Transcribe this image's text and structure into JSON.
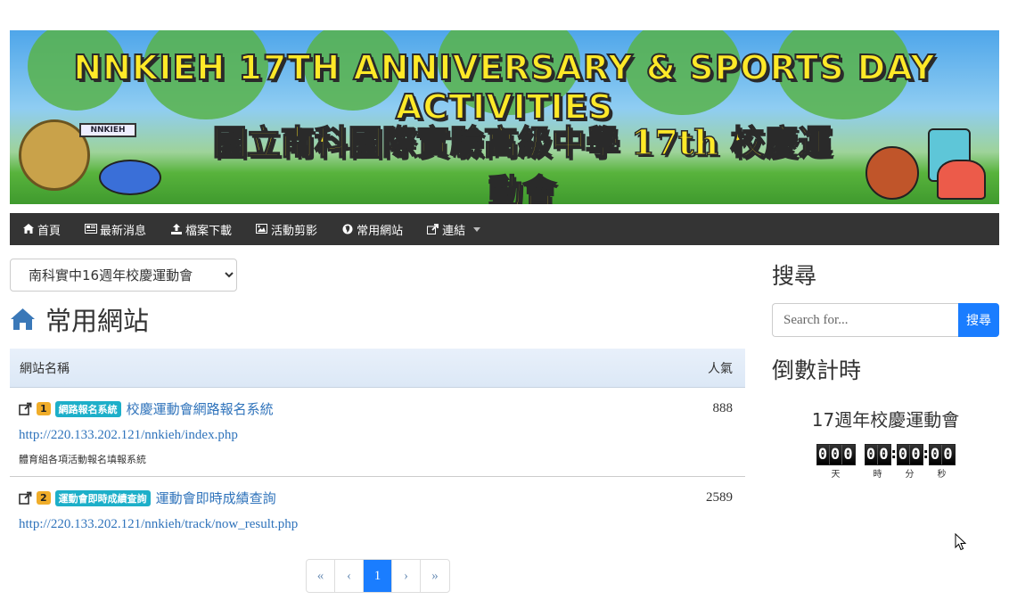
{
  "banner": {
    "title_en": "NNKIEH  17TH ANNIVERSARY & SPORTS DAY ACTIVITIES",
    "title_zh": "國立南科國際實驗高級中學 17th 校慶運動會",
    "sign": "NNKIEH"
  },
  "nav": {
    "items": [
      {
        "label": "首頁",
        "icon": "home-icon"
      },
      {
        "label": "最新消息",
        "icon": "newspaper-icon"
      },
      {
        "label": "檔案下載",
        "icon": "upload-icon"
      },
      {
        "label": "活動剪影",
        "icon": "image-icon"
      },
      {
        "label": "常用網站",
        "icon": "globe-icon"
      },
      {
        "label": "連結",
        "icon": "share-icon"
      }
    ]
  },
  "main": {
    "select_value": "南科實中16週年校慶運動會",
    "page_title": "常用網站",
    "table": {
      "col_name": "網站名稱",
      "col_count": "人氣",
      "rows": [
        {
          "num": "1",
          "category": "網路報名系統",
          "name": "校慶運動會網路報名系統",
          "count": "888",
          "url": "http://220.133.202.121/nnkieh/index.php",
          "desc": "體育組各項活動報名填報系統"
        },
        {
          "num": "2",
          "category": "運動會即時成績查詢",
          "name": "運動會即時成績查詢",
          "count": "2589",
          "url": "http://220.133.202.121/nnkieh/track/now_result.php",
          "desc": ""
        }
      ]
    },
    "pager": {
      "first": "«",
      "prev": "‹",
      "current": "1",
      "next": "›",
      "last": "»"
    }
  },
  "sidebar": {
    "search_title": "搜尋",
    "search_placeholder": "Search for...",
    "search_button": "搜尋",
    "countdown_title": "倒數計時",
    "countdown_event": "17週年校慶運動會",
    "countdown": {
      "days": "000",
      "hours": "00",
      "minutes": "00",
      "seconds": "00",
      "days_label": "天",
      "hours_label": "時",
      "minutes_label": "分",
      "seconds_label": "秒"
    }
  },
  "colors": {
    "nav_bg": "#343434",
    "primary": "#1a7dff",
    "link": "#2f73bb",
    "badge_num": "#f0ad2a",
    "badge_cat": "#1dafc9"
  }
}
